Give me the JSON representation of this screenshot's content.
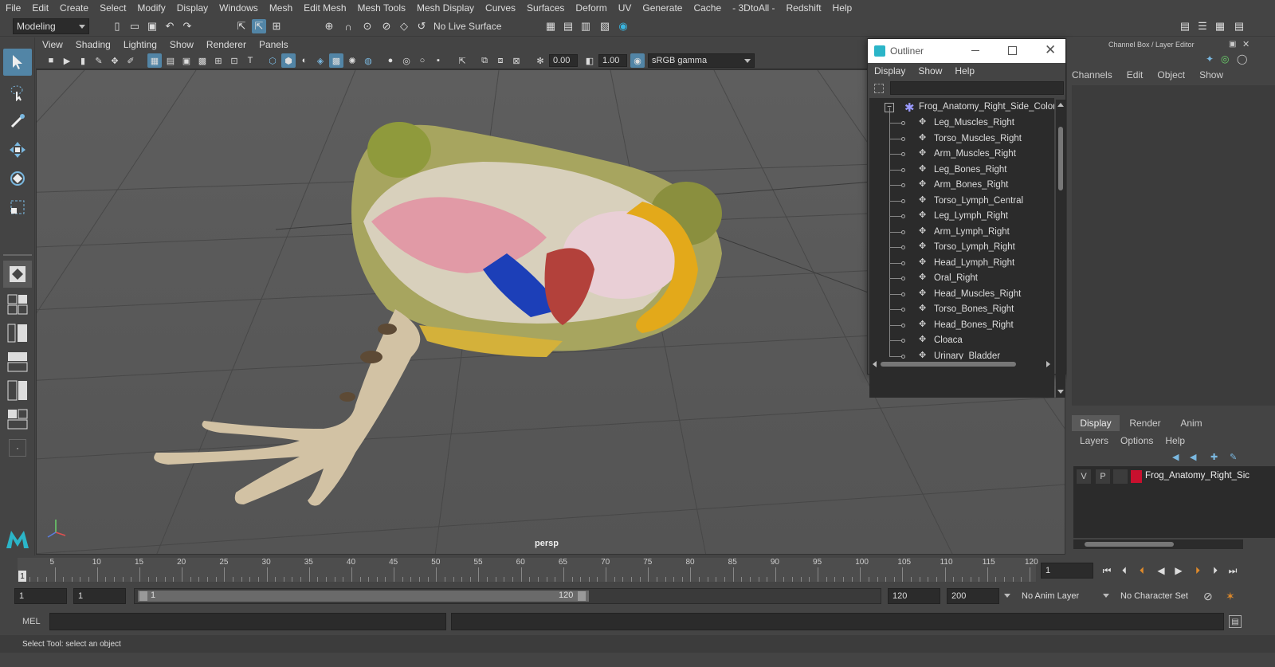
{
  "menubar": [
    "File",
    "Edit",
    "Create",
    "Select",
    "Modify",
    "Display",
    "Windows",
    "Mesh",
    "Edit Mesh",
    "Mesh Tools",
    "Mesh Display",
    "Curves",
    "Surfaces",
    "Deform",
    "UV",
    "Generate",
    "Cache",
    "- 3DtoAll -",
    "Redshift",
    "Help"
  ],
  "statusline": {
    "mode": "Modeling",
    "live_surface": "No Live Surface"
  },
  "viewport": {
    "menus": [
      "View",
      "Shading",
      "Lighting",
      "Show",
      "Renderer",
      "Panels"
    ],
    "exposure": "0.00",
    "gamma": "1.00",
    "color_space": "sRGB gamma",
    "camera_label": "persp"
  },
  "outliner": {
    "title": "Outliner",
    "menus": [
      "Display",
      "Show",
      "Help"
    ],
    "root": "Frog_Anatomy_Right_Side_Colore",
    "items": [
      "Leg_Muscles_Right",
      "Torso_Muscles_Right",
      "Arm_Muscles_Right",
      "Leg_Bones_Right",
      "Arm_Bones_Right",
      "Torso_Lymph_Central",
      "Leg_Lymph_Right",
      "Arm_Lymph_Right",
      "Torso_Lymph_Right",
      "Head_Lymph_Right",
      "Oral_Right",
      "Head_Muscles_Right",
      "Torso_Bones_Right",
      "Head_Bones_Right",
      "Cloaca",
      "Urinary_Bladder"
    ]
  },
  "channelbox": {
    "title": "Channel Box / Layer Editor",
    "menus": [
      "Channels",
      "Edit",
      "Object",
      "Show"
    ],
    "tabs": [
      "Display",
      "Render",
      "Anim"
    ],
    "layer_menus": [
      "Layers",
      "Options",
      "Help"
    ],
    "layer": {
      "v": "V",
      "p": "P",
      "name": "Frog_Anatomy_Right_Sic",
      "color": "#c8102e"
    }
  },
  "timeline": {
    "ticks": [
      "5",
      "10",
      "15",
      "20",
      "25",
      "30",
      "35",
      "40",
      "45",
      "50",
      "55",
      "60",
      "65",
      "70",
      "75",
      "80",
      "85",
      "90",
      "95",
      "100",
      "105",
      "110",
      "115",
      "120"
    ],
    "start_label": "1",
    "current_frame": "1"
  },
  "range": {
    "start": "1",
    "anim_start": "1",
    "slider_start": "1",
    "slider_end": "120",
    "end": "120",
    "anim_end": "200",
    "anim_layer": "No Anim Layer",
    "char_set": "No Character Set"
  },
  "cmdline": {
    "label": "MEL"
  },
  "helpline": {
    "text": "Select Tool: select an object"
  }
}
